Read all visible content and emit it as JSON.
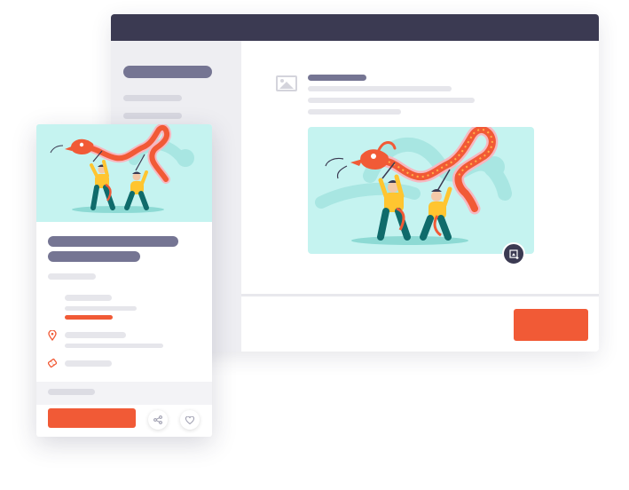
{
  "theme": {
    "titlebar": "#3b3a52",
    "accent": "#f15a36",
    "skeleton_dark": "#757593",
    "skeleton_light": "#e6e6eb",
    "media_bg": "#c5f3f0",
    "media_dragon_shadow": "#a8e6e2"
  },
  "back_window": {
    "sidebar": {
      "placeholder_items": 3
    },
    "header_placeholder": {
      "icon": "image-icon"
    },
    "media": {
      "illustration": "dragon-dance-illustration",
      "action_icon": "zoom-image-icon"
    },
    "footer": {
      "primary_button_label": ""
    }
  },
  "front_card": {
    "media": {
      "illustration": "dragon-dance-illustration"
    },
    "rows": [
      {
        "icon": "none"
      },
      {
        "icon": "map-pin-icon"
      },
      {
        "icon": "ticket-icon"
      }
    ],
    "actions": {
      "cta_label": "",
      "share_icon": "share-icon",
      "favorite_icon": "heart-icon"
    }
  }
}
